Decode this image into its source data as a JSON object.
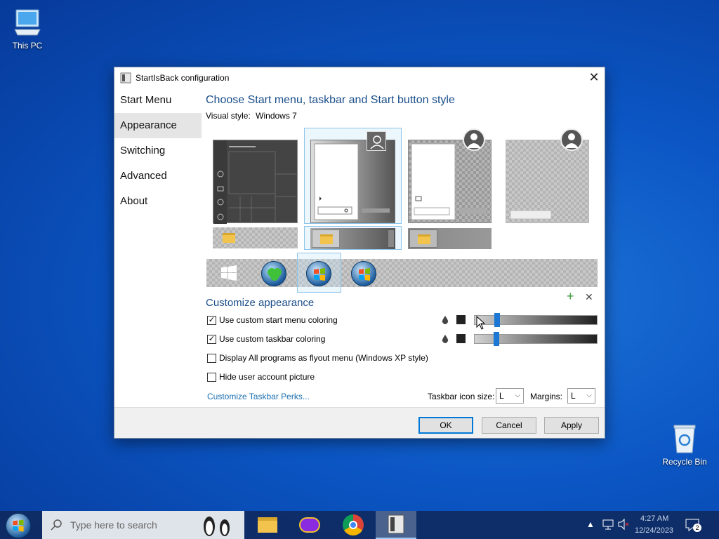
{
  "desktop": {
    "icons": [
      {
        "label": "This PC"
      },
      {
        "label": "Recycle Bin"
      }
    ]
  },
  "window": {
    "title": "StartIsBack configuration",
    "close_glyph": "✕",
    "sidebar": [
      {
        "label": "Start Menu"
      },
      {
        "label": "Appearance"
      },
      {
        "label": "Switching"
      },
      {
        "label": "Advanced"
      },
      {
        "label": "About"
      }
    ],
    "heading": "Choose Start menu, taskbar and Start button style",
    "visual_style_label": "Visual style:",
    "visual_style_value": "Windows 7",
    "customize_heading": "Customize appearance",
    "add_glyph": "+",
    "remove_glyph": "✕",
    "options": [
      {
        "label": "Use custom start menu coloring",
        "checked": true
      },
      {
        "label": "Use custom taskbar coloring",
        "checked": true
      },
      {
        "label": "Display All programs as flyout menu (Windows XP style)",
        "checked": false
      },
      {
        "label": "Hide user account picture",
        "checked": false
      }
    ],
    "check_mark": "✓",
    "perks_link": "Customize Taskbar Perks...",
    "icon_size_label": "Taskbar icon size:",
    "icon_size_value": "L",
    "margins_label": "Margins:",
    "margins_value": "L",
    "buttons": {
      "ok": "OK",
      "cancel": "Cancel",
      "apply": "Apply"
    },
    "slider_levels": [
      0.19,
      0.18
    ]
  },
  "taskbar": {
    "search_placeholder": "Type here to search",
    "time": "4:27 AM",
    "date": "12/24/2023",
    "notification_count": "2"
  },
  "colors": {
    "accent": "#0078d7",
    "heading": "#1a4e8a",
    "link": "#1a6fb0",
    "desktop": "#0b56c4"
  }
}
